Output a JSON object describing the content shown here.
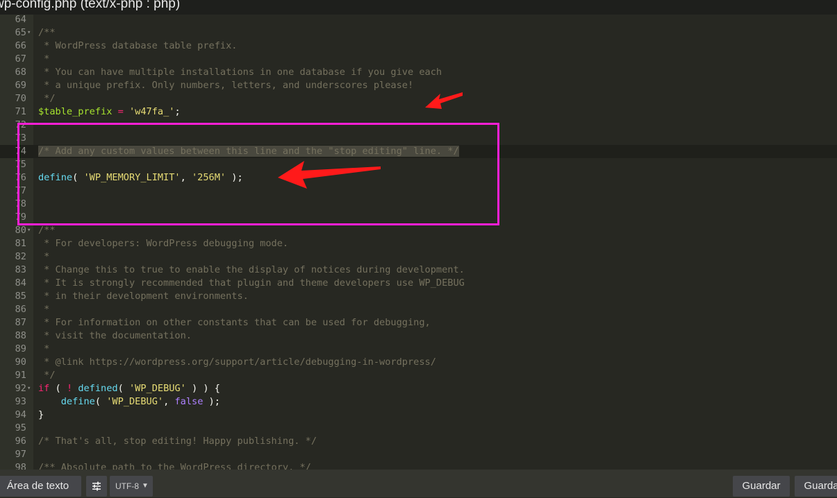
{
  "window": {
    "title": "wp-config.php (text/x-php : php)"
  },
  "editor": {
    "lines": [
      {
        "n": "64",
        "fold": "",
        "tokens": []
      },
      {
        "n": "65",
        "fold": "▾",
        "tokens": [
          {
            "t": "/**",
            "c": "comment"
          }
        ]
      },
      {
        "n": "66",
        "fold": "",
        "tokens": [
          {
            "t": " * WordPress database table prefix.",
            "c": "comment"
          }
        ]
      },
      {
        "n": "67",
        "fold": "",
        "tokens": [
          {
            "t": " *",
            "c": "comment"
          }
        ]
      },
      {
        "n": "68",
        "fold": "",
        "tokens": [
          {
            "t": " * You can have multiple installations in one database if you give each",
            "c": "comment"
          }
        ]
      },
      {
        "n": "69",
        "fold": "",
        "tokens": [
          {
            "t": " * a unique prefix. Only numbers, letters, and underscores please!",
            "c": "comment"
          }
        ]
      },
      {
        "n": "70",
        "fold": "",
        "tokens": [
          {
            "t": " */",
            "c": "comment"
          }
        ]
      },
      {
        "n": "71",
        "fold": "",
        "tokens": [
          {
            "t": "$table_prefix",
            "c": "var"
          },
          {
            "t": " ",
            "c": "plain"
          },
          {
            "t": "=",
            "c": "op"
          },
          {
            "t": " ",
            "c": "plain"
          },
          {
            "t": "'w47fa_'",
            "c": "str"
          },
          {
            "t": ";",
            "c": "plain"
          }
        ]
      },
      {
        "n": "72",
        "fold": "",
        "tokens": []
      },
      {
        "n": "73",
        "fold": "",
        "tokens": []
      },
      {
        "n": "74",
        "fold": "",
        "active": true,
        "tokens": [
          {
            "t": "/* Add any custom values between this line and the \"stop editing\" line. */",
            "c": "comment",
            "sel": true
          }
        ]
      },
      {
        "n": "75",
        "fold": "",
        "tokens": []
      },
      {
        "n": "76",
        "fold": "",
        "tokens": [
          {
            "t": "define",
            "c": "fn"
          },
          {
            "t": "( ",
            "c": "plain"
          },
          {
            "t": "'WP_MEMORY_LIMIT'",
            "c": "str"
          },
          {
            "t": ", ",
            "c": "plain"
          },
          {
            "t": "'256M'",
            "c": "str"
          },
          {
            "t": " );",
            "c": "plain"
          }
        ]
      },
      {
        "n": "77",
        "fold": "",
        "tokens": []
      },
      {
        "n": "78",
        "fold": "",
        "tokens": []
      },
      {
        "n": "79",
        "fold": "",
        "tokens": []
      },
      {
        "n": "80",
        "fold": "▾",
        "tokens": [
          {
            "t": "/**",
            "c": "comment"
          }
        ]
      },
      {
        "n": "81",
        "fold": "",
        "tokens": [
          {
            "t": " * For developers: WordPress debugging mode.",
            "c": "comment"
          }
        ]
      },
      {
        "n": "82",
        "fold": "",
        "tokens": [
          {
            "t": " *",
            "c": "comment"
          }
        ]
      },
      {
        "n": "83",
        "fold": "",
        "tokens": [
          {
            "t": " * Change this to true to enable the display of notices during development.",
            "c": "comment"
          }
        ]
      },
      {
        "n": "84",
        "fold": "",
        "tokens": [
          {
            "t": " * It is strongly recommended that plugin and theme developers use WP_DEBUG",
            "c": "comment"
          }
        ]
      },
      {
        "n": "85",
        "fold": "",
        "tokens": [
          {
            "t": " * in their development environments.",
            "c": "comment"
          }
        ]
      },
      {
        "n": "86",
        "fold": "",
        "tokens": [
          {
            "t": " *",
            "c": "comment"
          }
        ]
      },
      {
        "n": "87",
        "fold": "",
        "tokens": [
          {
            "t": " * For information on other constants that can be used for debugging,",
            "c": "comment"
          }
        ]
      },
      {
        "n": "88",
        "fold": "",
        "tokens": [
          {
            "t": " * visit the documentation.",
            "c": "comment"
          }
        ]
      },
      {
        "n": "89",
        "fold": "",
        "tokens": [
          {
            "t": " *",
            "c": "comment"
          }
        ]
      },
      {
        "n": "90",
        "fold": "",
        "tokens": [
          {
            "t": " * @link https://wordpress.org/support/article/debugging-in-wordpress/",
            "c": "comment"
          }
        ]
      },
      {
        "n": "91",
        "fold": "",
        "tokens": [
          {
            "t": " */",
            "c": "comment"
          }
        ]
      },
      {
        "n": "92",
        "fold": "▾",
        "tokens": [
          {
            "t": "if",
            "c": "op"
          },
          {
            "t": " ( ",
            "c": "plain"
          },
          {
            "t": "!",
            "c": "op"
          },
          {
            "t": " ",
            "c": "plain"
          },
          {
            "t": "defined",
            "c": "fn"
          },
          {
            "t": "( ",
            "c": "plain"
          },
          {
            "t": "'WP_DEBUG'",
            "c": "str"
          },
          {
            "t": " ) ) {",
            "c": "plain"
          }
        ]
      },
      {
        "n": "93",
        "fold": "",
        "tokens": [
          {
            "t": "    ",
            "c": "plain"
          },
          {
            "t": "define",
            "c": "fn"
          },
          {
            "t": "( ",
            "c": "plain"
          },
          {
            "t": "'WP_DEBUG'",
            "c": "str"
          },
          {
            "t": ", ",
            "c": "plain"
          },
          {
            "t": "false",
            "c": "const"
          },
          {
            "t": " );",
            "c": "plain"
          }
        ]
      },
      {
        "n": "94",
        "fold": "",
        "tokens": [
          {
            "t": "}",
            "c": "plain"
          }
        ]
      },
      {
        "n": "95",
        "fold": "",
        "tokens": []
      },
      {
        "n": "96",
        "fold": "",
        "tokens": [
          {
            "t": "/* That's all, stop editing! Happy publishing. */",
            "c": "comment"
          }
        ]
      },
      {
        "n": "97",
        "fold": "",
        "tokens": []
      },
      {
        "n": "98",
        "fold": "",
        "tokens": [
          {
            "t": "/** Absolute path to the WordPress directory. */",
            "c": "comment"
          }
        ]
      }
    ]
  },
  "statusbar": {
    "textarea_label": "Área de texto",
    "settings_icon": "sliders-icon",
    "encoding": "UTF-8",
    "save_label": "Guardar",
    "save2_label": "Guardar"
  },
  "annotations": {
    "box_color": "#ff1fd6",
    "arrow_color": "#ff1a1a"
  },
  "colors": {
    "background": "#272822",
    "comment": "#75715e",
    "string": "#e6db74",
    "keyword": "#f92672",
    "function": "#66d9ef",
    "variable": "#a6e22e",
    "constant": "#ae81ff"
  }
}
